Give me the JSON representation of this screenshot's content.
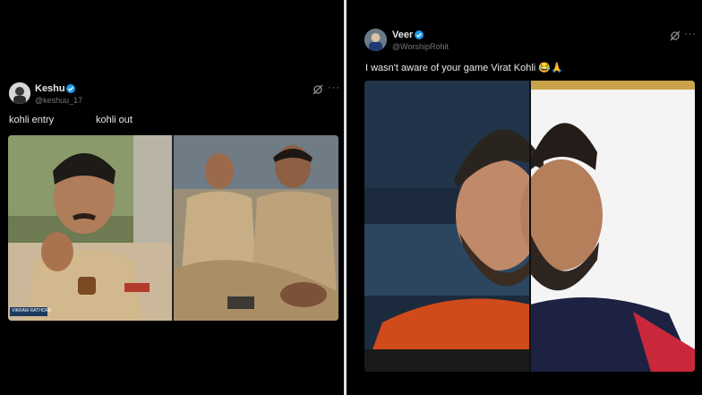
{
  "left_post": {
    "name": "Keshu",
    "handle": "@keshuu_17",
    "caption_left": "kohli entry",
    "caption_right": "kohli out",
    "badge_text": "VIKRAM RATHORE"
  },
  "right_post": {
    "name": "Veer",
    "handle": "@WorshipRohit",
    "text": "I wasn't aware of your game Virat Kohli 😂🙏"
  },
  "icons": {
    "grok": "grok-icon",
    "more": "more-icon",
    "verified": "verified-badge-icon"
  },
  "colors": {
    "background": "#000000",
    "verified": "#1d9bf0",
    "handle": "#71767b",
    "divider": "#e0e0e0"
  }
}
